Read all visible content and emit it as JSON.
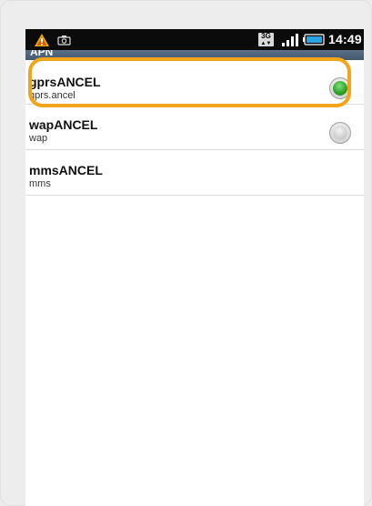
{
  "status_bar": {
    "network_type": "3G",
    "time": "14:49",
    "icons": [
      "warning-icon",
      "camera-icon",
      "network-3g-icon",
      "signal-icon",
      "battery-icon"
    ]
  },
  "title_bar": {
    "title": "APN"
  },
  "apn_list": [
    {
      "name": "gprsANCEL",
      "apn": "gprs.ancel",
      "selected": true
    },
    {
      "name": "wapANCEL",
      "apn": "wap",
      "selected": false
    },
    {
      "name": "mmsANCEL",
      "apn": "mms",
      "selected": null
    }
  ],
  "colors": {
    "highlight": "#f2a51a",
    "selected_radio": "#2fa52c",
    "status_bar": "#0b0b0b"
  }
}
